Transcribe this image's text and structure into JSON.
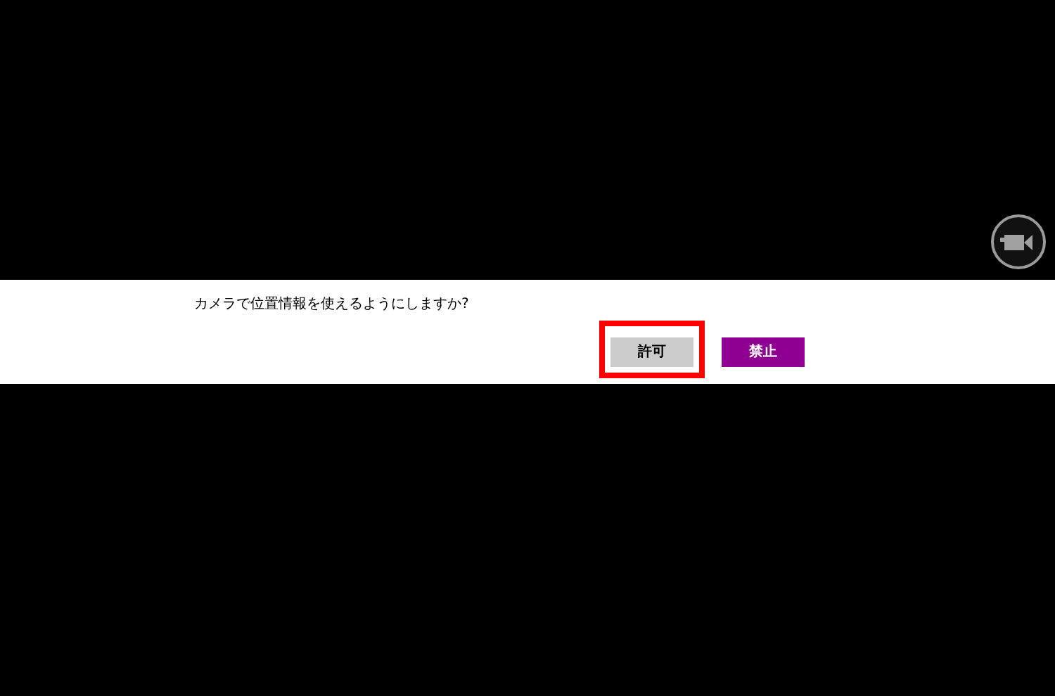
{
  "dialog": {
    "message": "カメラで位置情報を使えるようにしますか?",
    "buttons": [
      {
        "label": "許可",
        "kind": "default",
        "highlighted": true
      },
      {
        "label": "禁止",
        "kind": "accent",
        "highlighted": false
      }
    ]
  }
}
